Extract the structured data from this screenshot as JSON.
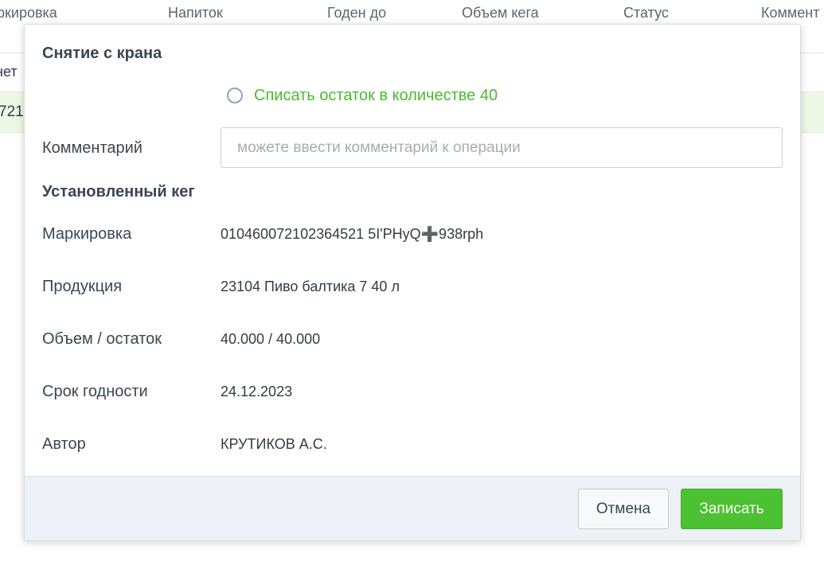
{
  "background_table": {
    "columns": [
      "ркировка",
      "Напиток",
      "Годен до",
      "Объем кега",
      "Статус",
      "Коммент"
    ],
    "row_1_cell": "нет",
    "row_2_cell": "721"
  },
  "modal": {
    "title": "Снятие с крана",
    "writeoff_option": "Списать остаток в количестве 40",
    "comment_label": "Комментарий",
    "comment_value": "",
    "comment_placeholder": "можете ввести комментарий к операции",
    "installed_keg_title": "Установленный кег",
    "fields": [
      {
        "label": "Маркировка",
        "value": "010460072102364521 5I'PHyQ➕938rph"
      },
      {
        "label": "Продукция",
        "value": "23104 Пиво балтика 7 40 л"
      },
      {
        "label": "Объем / остаток",
        "value": "40.000 / 40.000"
      },
      {
        "label": "Срок годности",
        "value": "24.12.2023"
      },
      {
        "label": "Автор",
        "value": "КРУТИКОВ А.С."
      }
    ],
    "cancel_label": "Отмена",
    "save_label": "Записать"
  },
  "colors": {
    "accent_green": "#4cc131",
    "option_text_green": "#4cba2c",
    "selected_row_bg": "#ecf8e4",
    "footer_bg": "#edf1f5"
  }
}
